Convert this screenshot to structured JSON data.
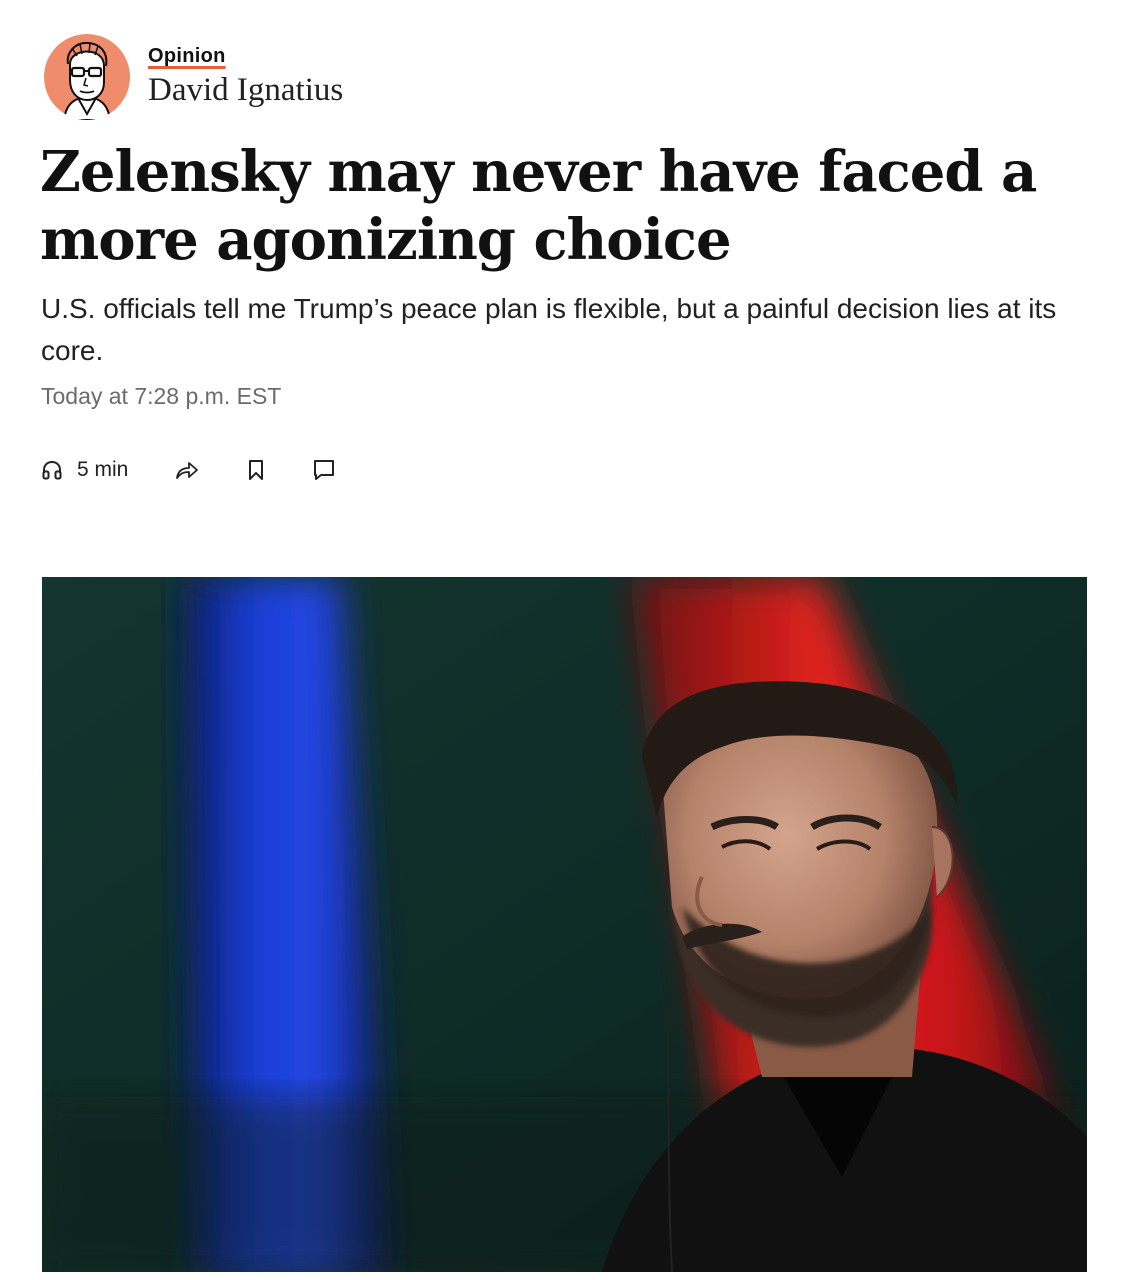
{
  "byline": {
    "section_label": "Opinion",
    "author": "David Ignatius",
    "accent_color": "#e0603c",
    "avatar_background": "#ee8c6c"
  },
  "article": {
    "headline": "Zelensky may never have faced a more agonizing choice",
    "subheadline": "U.S. officials tell me Trump’s peace plan is flexible, but a painful decision lies at its core.",
    "timestamp": "Today at 7:28 p.m. EST"
  },
  "actions": {
    "listen_icon": "headphones-icon",
    "listen_duration": "5 min",
    "share_icon": "share-icon",
    "save_icon": "bookmark-icon",
    "comment_icon": "comment-icon"
  },
  "lead_image": {
    "description_icon": "photo"
  }
}
